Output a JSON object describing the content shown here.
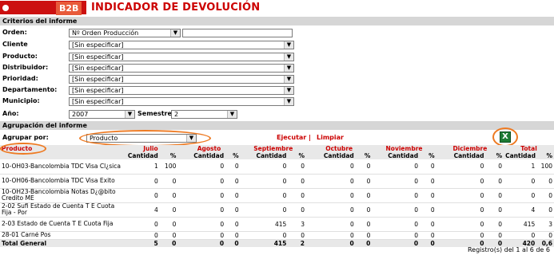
{
  "header": {
    "badge": "B2B",
    "title": "INDICADOR DE DEVOLUCIÓN"
  },
  "criteria": {
    "section_title": "Criterios del informe",
    "fields": [
      {
        "label": "Orden:",
        "value": "Nº Orden Producción"
      },
      {
        "label": "Cliente",
        "value": "[Sin especificar]"
      },
      {
        "label": "Producto:",
        "value": "[Sin especificar]"
      },
      {
        "label": "Distribuidor:",
        "value": "[Sin especificar]"
      },
      {
        "label": "Prioridad:",
        "value": "[Sin especificar]"
      },
      {
        "label": "Departamento:",
        "value": "[Sin especificar]"
      },
      {
        "label": "Municipio:",
        "value": "[Sin especificar]"
      }
    ],
    "year_label": "Año:",
    "year_value": "2007",
    "semester_label": "Semestre:",
    "semester_value": "2"
  },
  "grouping": {
    "section_title": "Agrupación del informe",
    "group_label": "Agrupar por:",
    "group_value": "Producto",
    "execute": "Ejecutar",
    "separator": "|",
    "clear": "Limpiar"
  },
  "table": {
    "product_header": "Producto",
    "months": [
      "Julio",
      "Agosto",
      "Septiembre",
      "Octubre",
      "Noviembre",
      "Diciembre",
      "Total"
    ],
    "sub_qty": "Cantidad",
    "sub_pct": "%",
    "rows": [
      {
        "product": "10-OH03-Bancolombia TDC Visa Cl¿sica",
        "cells": [
          "1",
          "100",
          "0",
          "0",
          "0",
          "0",
          "0",
          "0",
          "0",
          "0",
          "0",
          "0",
          "1",
          "100"
        ]
      },
      {
        "product": "10-OH06-Bancolombia TDC Visa Exito",
        "cells": [
          "0",
          "0",
          "0",
          "0",
          "0",
          "0",
          "0",
          "0",
          "0",
          "0",
          "0",
          "0",
          "0",
          "0"
        ]
      },
      {
        "product": "10-OH23-Bancolombia Notas D¿@bito Credito ME",
        "cells": [
          "0",
          "0",
          "0",
          "0",
          "0",
          "0",
          "0",
          "0",
          "0",
          "0",
          "0",
          "0",
          "0",
          "0"
        ]
      },
      {
        "product": "2-02 Sufi Estado de Cuenta T E Cuota Fija - Por",
        "cells": [
          "4",
          "0",
          "0",
          "0",
          "0",
          "0",
          "0",
          "0",
          "0",
          "0",
          "0",
          "0",
          "4",
          "0"
        ]
      },
      {
        "product": "2-03 Estado de Cuenta T E Cuota Fija",
        "cells": [
          "0",
          "0",
          "0",
          "0",
          "415",
          "3",
          "0",
          "0",
          "0",
          "0",
          "0",
          "0",
          "415",
          "3"
        ]
      },
      {
        "product": "28-01 Carné Pos",
        "cells": [
          "0",
          "0",
          "0",
          "0",
          "0",
          "0",
          "0",
          "0",
          "0",
          "0",
          "0",
          "0",
          "0",
          "0"
        ]
      }
    ],
    "total": {
      "label": "Total General",
      "cells": [
        "5",
        "0",
        "0",
        "0",
        "415",
        "2",
        "0",
        "0",
        "0",
        "0",
        "0",
        "0",
        "420",
        "0,6"
      ]
    }
  },
  "footer": {
    "records": "Registro(s) del 1 al 6 de 6"
  },
  "colors": {
    "accent": "#cc0000",
    "highlight": "#ee7a22"
  },
  "icons": {
    "export": "excel-icon"
  }
}
